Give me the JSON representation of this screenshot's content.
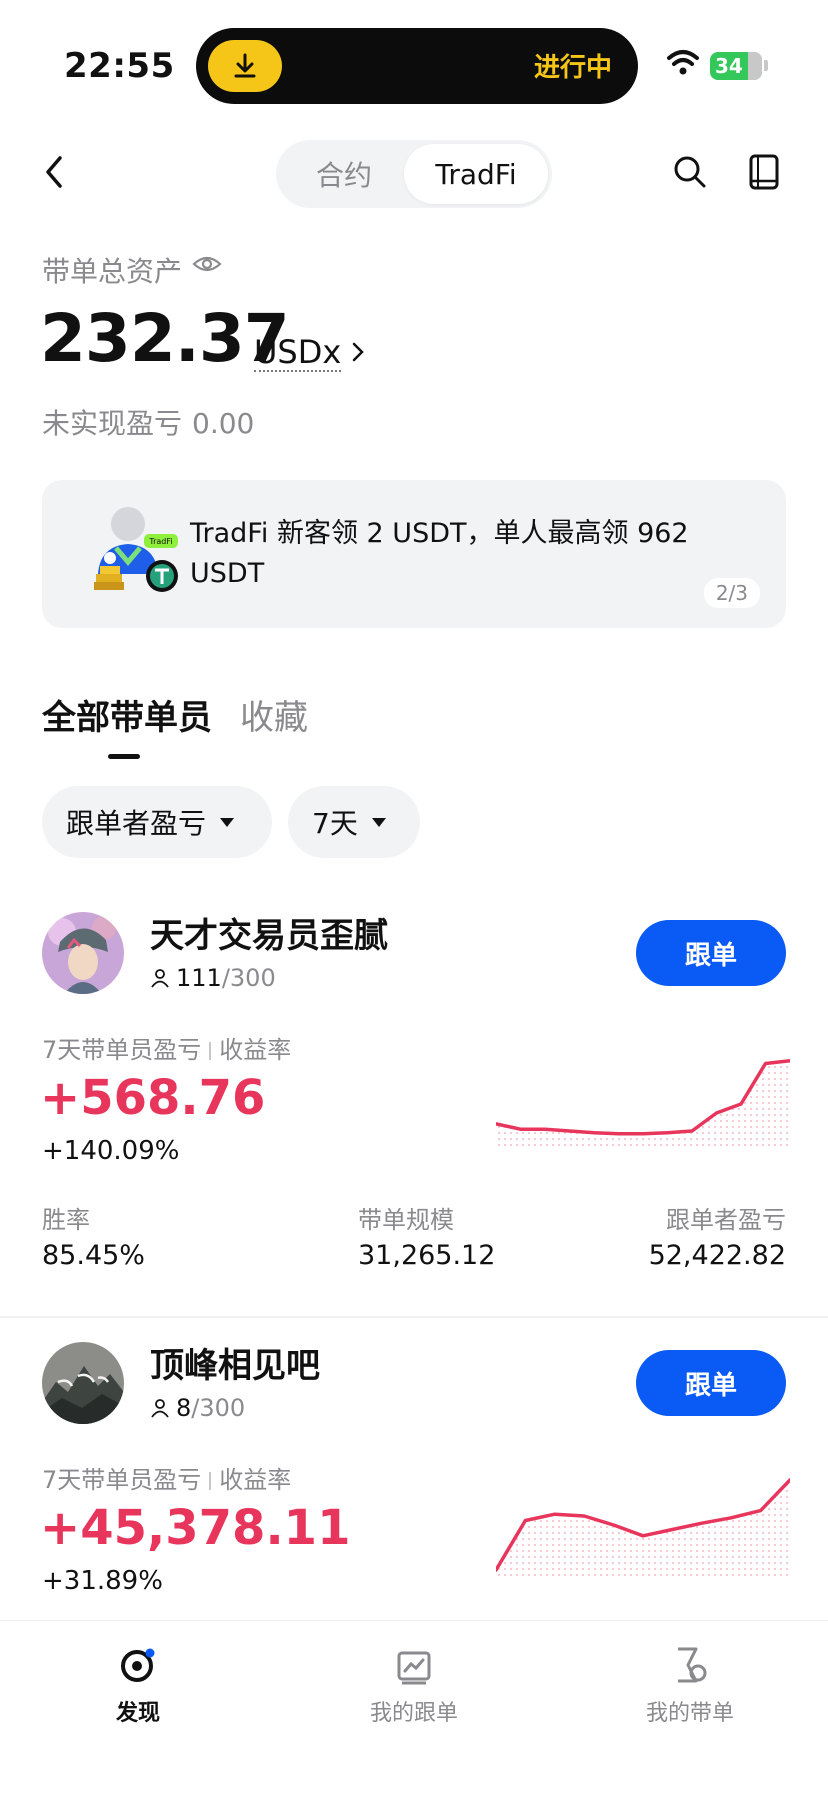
{
  "status_bar": {
    "time": "22:55",
    "activity_text": "进行中",
    "battery": "34"
  },
  "header": {
    "tabs": [
      "合约",
      "TradFi"
    ],
    "active_tab": "TradFi"
  },
  "assets": {
    "label": "带单总资产",
    "value": "232.37",
    "unit": "USDx",
    "unrealized_label": "未实现盈亏",
    "unrealized_value": "0.00"
  },
  "banner": {
    "text": "TradFi 新客领 2 USDT，单人最高领 962 USDT",
    "page": "2/3",
    "badge": "TradFi"
  },
  "tabs": {
    "all": "全部带单员",
    "favorites": "收藏"
  },
  "filters": {
    "sort": "跟单者盈亏",
    "period": "7天"
  },
  "traders": [
    {
      "name": "天才交易员歪腻",
      "followers": "111",
      "max_followers": "/300",
      "follow_label": "跟单",
      "metric_label_a": "7天带单员盈亏",
      "metric_label_b": "收益率",
      "pnl": "+568.76",
      "roi": "+140.09%",
      "stats": [
        {
          "label": "胜率",
          "value": "85.45%"
        },
        {
          "label": "带单规模",
          "value": "31,265.12"
        },
        {
          "label": "跟单者盈亏",
          "value": "52,422.82"
        }
      ],
      "sparkline": [
        0.18,
        0.12,
        0.12,
        0.1,
        0.08,
        0.07,
        0.07,
        0.08,
        0.1,
        0.3,
        0.4,
        0.85,
        0.88
      ]
    },
    {
      "name": "顶峰相见吧",
      "followers": "8",
      "max_followers": "/300",
      "follow_label": "跟单",
      "metric_label_a": "7天带单员盈亏",
      "metric_label_b": "收益率",
      "pnl": "+45,378.11",
      "roi": "+31.89%",
      "sparkline": [
        0.0,
        0.55,
        0.62,
        0.6,
        0.5,
        0.38,
        0.45,
        0.52,
        0.58,
        0.66,
        1.0
      ]
    }
  ],
  "bottom_nav": [
    {
      "label": "发现",
      "icon": "discover-icon",
      "active": true
    },
    {
      "label": "我的跟单",
      "icon": "copy-trade-icon",
      "active": false
    },
    {
      "label": "我的带单",
      "icon": "lead-trade-icon",
      "active": false
    }
  ],
  "colors": {
    "accent": "#0a5af5",
    "profit": "#e8355c",
    "muted": "#8a8a8e"
  }
}
